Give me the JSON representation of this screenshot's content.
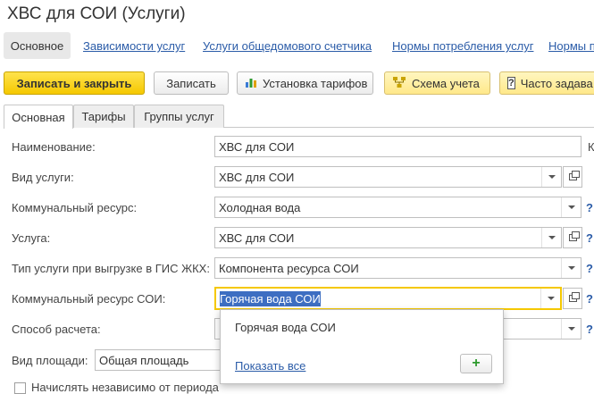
{
  "window": {
    "title": "ХВС для СОИ (Услуги)"
  },
  "nav": {
    "active": "Основное",
    "links": [
      "Зависимости услуг",
      "Услуги общедомового счетчика",
      "Нормы потребления услуг",
      "Нормы п"
    ]
  },
  "toolbar": {
    "save_close": "Записать и закрыть",
    "save": "Записать",
    "tariffs": "Установка тарифов",
    "scheme": "Схема учета",
    "faq": "Часто задава"
  },
  "tabs": [
    "Основная",
    "Тарифы",
    "Группы услуг"
  ],
  "form": {
    "name": {
      "label": "Наименование:",
      "value": "ХВС для СОИ",
      "side": "К"
    },
    "service_type": {
      "label": "Вид услуги:",
      "value": "ХВС для СОИ"
    },
    "resource": {
      "label": "Коммунальный ресурс:",
      "value": "Холодная вода"
    },
    "service": {
      "label": "Услуга:",
      "value": "ХВС для СОИ"
    },
    "gis_type": {
      "label": "Тип услуги при выгрузке в ГИС ЖКХ:",
      "value": "Компонента ресурса СОИ"
    },
    "resource_soi": {
      "label": "Коммунальный ресурс СОИ:",
      "value": "Горячая вода СОИ"
    },
    "calc_method": {
      "label": "Способ расчета:"
    },
    "area_type": {
      "label": "Вид площади:",
      "value": "Общая площадь"
    },
    "independent": {
      "label": "Начислять независимо от периода"
    }
  },
  "help": "?",
  "popup": {
    "item": "Горячая вода СОИ",
    "show_all": "Показать все",
    "add": "+"
  },
  "colors": {
    "accent": "#f5c800",
    "link": "#2b5ca8",
    "selection": "#3d6ec2"
  }
}
